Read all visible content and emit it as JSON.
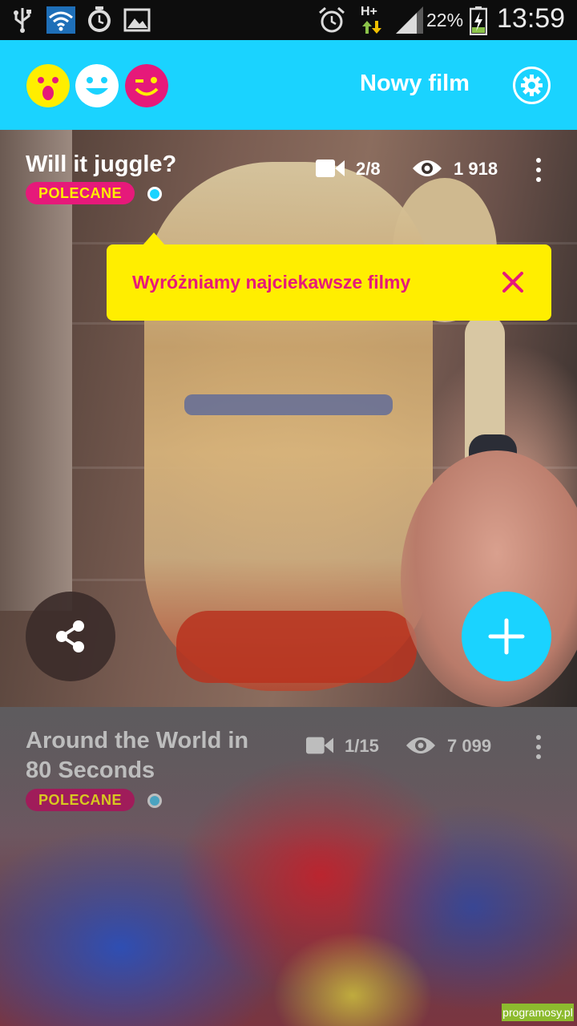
{
  "status_bar": {
    "battery": "22%",
    "time": "13:59",
    "network": "H+",
    "icons": [
      "usb-icon",
      "wifi-icon",
      "alarm-app-icon",
      "gallery-icon",
      "alarm-clock-icon",
      "signal-icon",
      "battery-charging-icon"
    ]
  },
  "app_bar": {
    "title": "Nowy film",
    "icons": [
      "surprised-face-icon",
      "smile-face-icon",
      "wink-face-icon",
      "settings-gear-icon"
    ],
    "colors": {
      "bar": "#1ad3ff",
      "yellow": "#ffee00",
      "pink": "#e6197a"
    }
  },
  "videos": [
    {
      "title": "Will it juggle?",
      "badge": "POLECANE",
      "clips": "2/8",
      "views": "1 918"
    },
    {
      "title_line1": "Around the World in",
      "title_line2": "80 Seconds",
      "badge": "POLECANE",
      "clips": "1/15",
      "views": "7 099"
    }
  ],
  "tooltip": {
    "text": "Wyróżniamy najciekawsze filmy"
  },
  "watermark": "programosy.pl"
}
